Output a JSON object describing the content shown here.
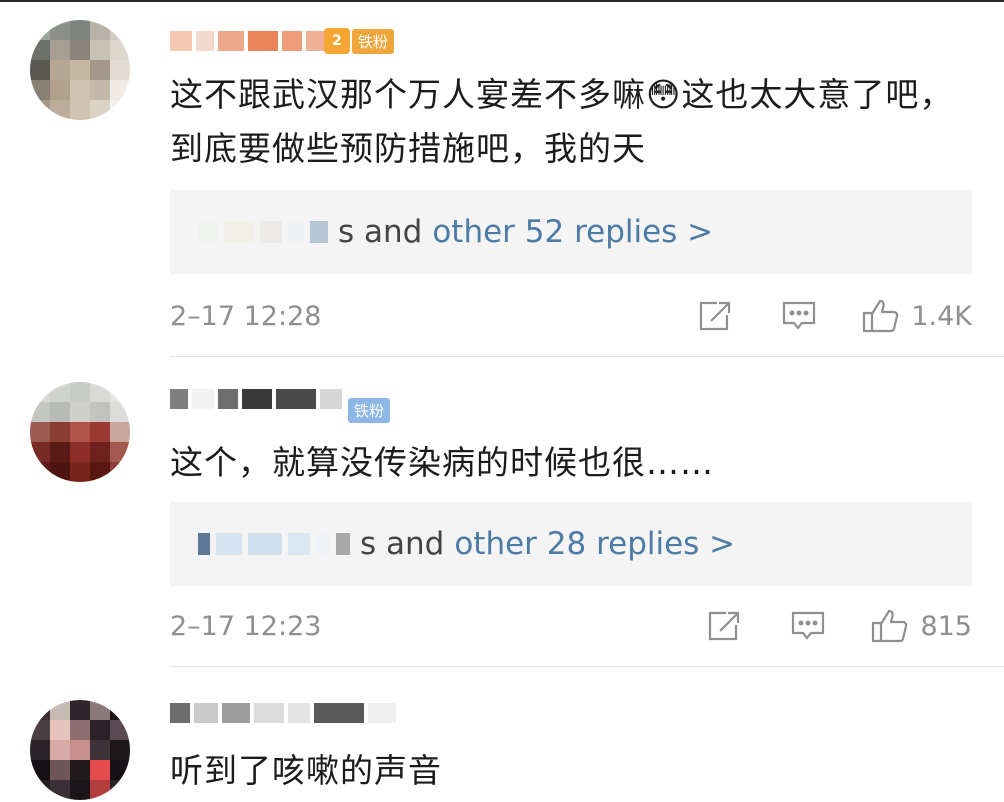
{
  "comments": [
    {
      "body": "这不跟武汉那个万人宴差不多嘛😳这也太大意了吧，到底要做些预防措施吧，我的天",
      "badge": {
        "level": "2",
        "label": "铁粉"
      },
      "replies": {
        "tail": "s and",
        "link": "other 52 replies >"
      },
      "time": "2–17 12:28",
      "likes": "1.4K"
    },
    {
      "body": "这个，就算没传染病的时候也很……",
      "badge": {
        "level": "",
        "label": "铁粉"
      },
      "replies": {
        "tail": "s and",
        "link": "other 28 replies >"
      },
      "time": "2–17 12:23",
      "likes": "815"
    },
    {
      "body": "听到了咳嗽的声音"
    }
  ],
  "colors": {
    "link": "#4c7ba6",
    "meta": "#8f8f8f",
    "reply_bg": "#f4f4f4",
    "badge_gold": "#f1a63c",
    "badge_blue": "#8cb7e6"
  },
  "icons": {
    "share": "share-icon",
    "comment": "comment-icon",
    "like": "thumbs-up-icon"
  }
}
